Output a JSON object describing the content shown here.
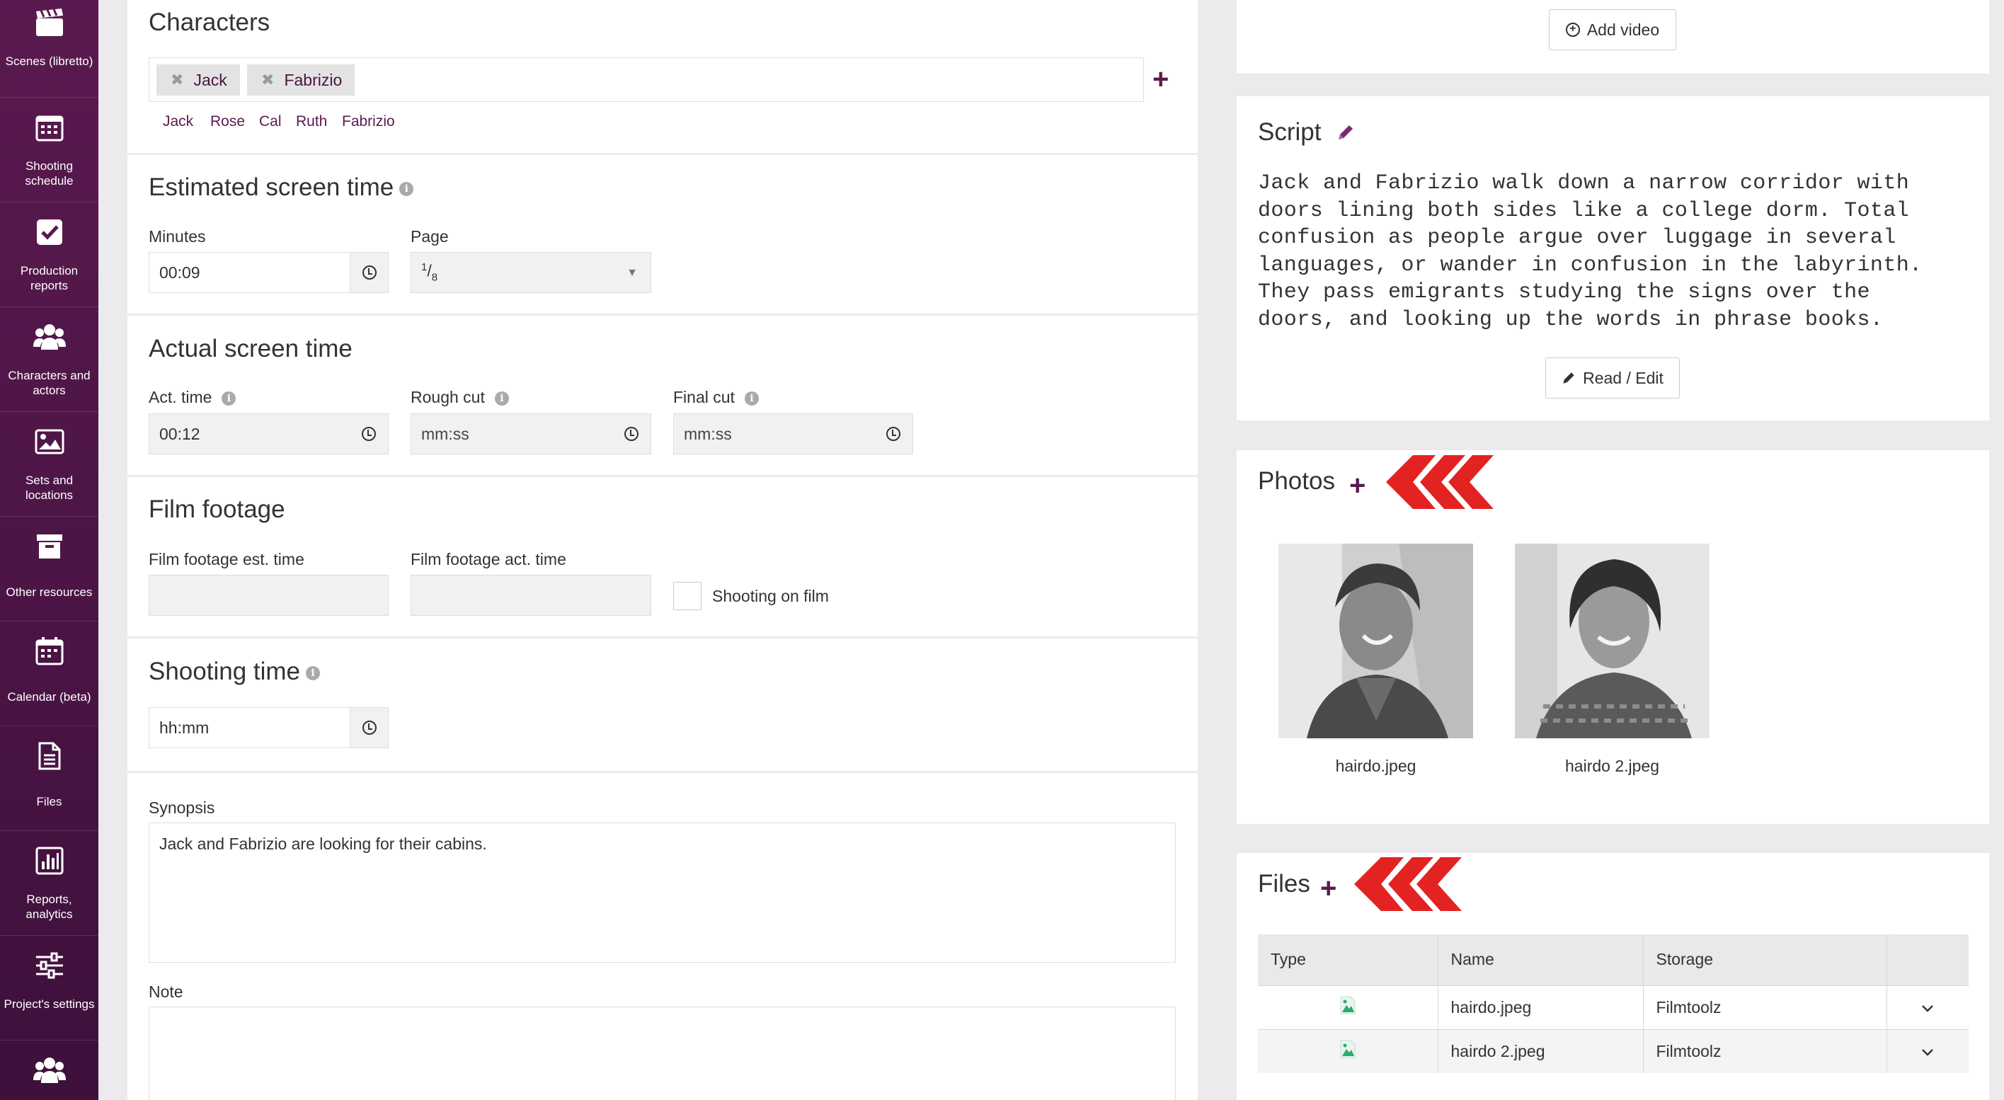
{
  "sidebar": {
    "items": [
      {
        "label": "Scenes (libretto)",
        "icon": "clapperboard-icon"
      },
      {
        "label": "Shooting schedule",
        "icon": "calendar-grid-icon"
      },
      {
        "label": "Production reports",
        "icon": "checkbox-icon"
      },
      {
        "label": "Characters and actors",
        "icon": "people-icon"
      },
      {
        "label": "Sets and locations",
        "icon": "image-icon"
      },
      {
        "label": "Other resources",
        "icon": "archive-box-icon"
      },
      {
        "label": "Calendar (beta)",
        "icon": "calendar-icon"
      },
      {
        "label": "Files",
        "icon": "file-icon"
      },
      {
        "label": "Reports, analytics",
        "icon": "bar-chart-icon"
      },
      {
        "label": "Project's settings",
        "icon": "sliders-icon"
      },
      {
        "label": "",
        "icon": "people-icon"
      }
    ]
  },
  "characters": {
    "title": "Characters",
    "tags": [
      "Jack",
      "Fabrizio"
    ],
    "tag_remove_glyph": "✖",
    "suggestions": [
      "Jack",
      "Rose",
      "Cal",
      "Ruth",
      "Fabrizio"
    ],
    "add_glyph": "+"
  },
  "estimated": {
    "title": "Estimated screen time",
    "minutes_label": "Minutes",
    "minutes_value": "00:09",
    "page_label": "Page",
    "page_value_num": "1",
    "page_value_den": "8"
  },
  "actual": {
    "title": "Actual screen time",
    "act_label": "Act. time",
    "act_value": "00:12",
    "rough_label": "Rough cut",
    "rough_placeholder": "mm:ss",
    "final_label": "Final cut",
    "final_placeholder": "mm:ss"
  },
  "film": {
    "title": "Film footage",
    "est_label": "Film footage est. time",
    "act_label": "Film footage act. time",
    "checkbox_label": "Shooting on film"
  },
  "shooting": {
    "title": "Shooting time",
    "placeholder": "hh:mm"
  },
  "synopsis": {
    "label": "Synopsis",
    "value": "Jack and Fabrizio are looking for their cabins."
  },
  "note": {
    "label": "Note",
    "value": ""
  },
  "video": {
    "add_label": "Add video"
  },
  "script": {
    "title": "Script",
    "lines": [
      "Jack and Fabrizio walk down a narrow corridor with",
      "doors lining both sides like a college dorm. Total",
      "confusion as people argue over luggage in several",
      "languages, or wander in confusion in the labyrinth.",
      "They pass emigrants studying the signs over the",
      "doors, and looking up the words in phrase books."
    ],
    "read_edit_label": "Read / Edit"
  },
  "photos": {
    "title": "Photos",
    "items": [
      {
        "caption": "hairdo.jpeg"
      },
      {
        "caption": "hairdo 2.jpeg"
      }
    ]
  },
  "files": {
    "title": "Files",
    "columns": [
      "Type",
      "Name",
      "Storage",
      ""
    ],
    "rows": [
      {
        "name": "hairdo.jpeg",
        "storage": "Filmtoolz"
      },
      {
        "name": "hairdo 2.jpeg",
        "storage": "Filmtoolz"
      }
    ]
  },
  "colors": {
    "brand": "#5a1a4f",
    "accent_red": "#e32222"
  }
}
